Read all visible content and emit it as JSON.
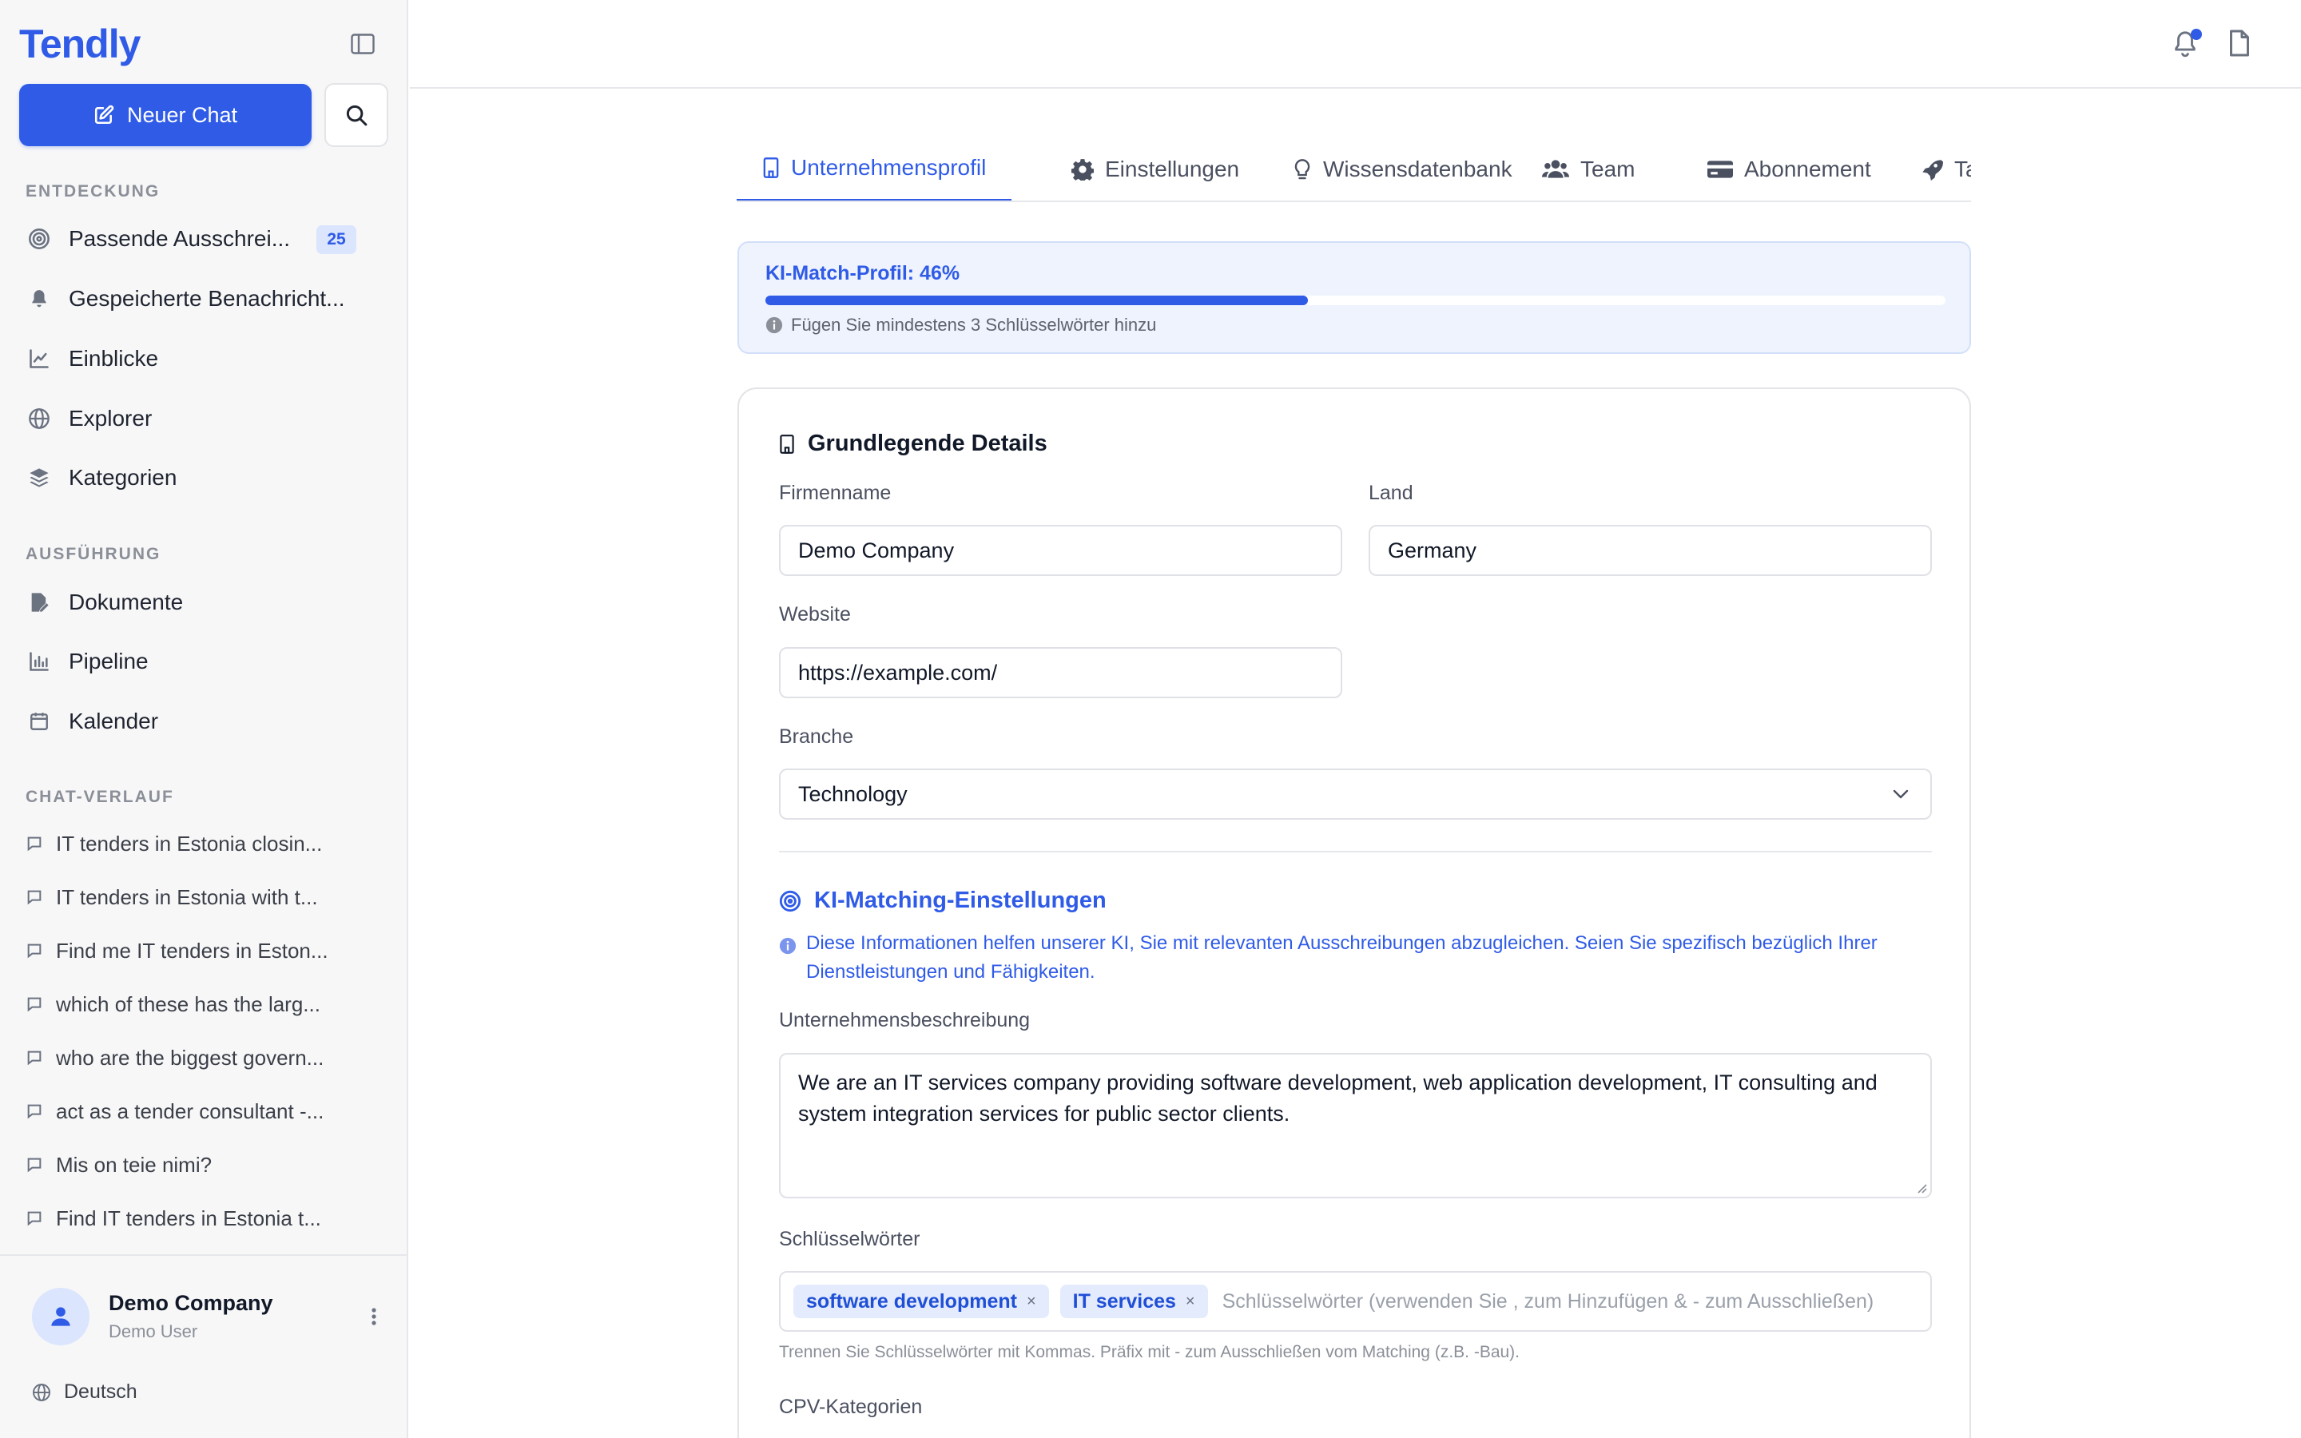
{
  "app": {
    "logo": "Tendly"
  },
  "sidebar": {
    "new_chat_label": "Neuer Chat",
    "sections": {
      "discovery": "ENTDECKUNG",
      "execution": "AUSFÜHRUNG",
      "history": "CHAT-VERLAUF"
    },
    "discovery_items": [
      {
        "label": "Passende Ausschrei...",
        "icon": "target-icon",
        "badge": "25"
      },
      {
        "label": "Gespeicherte Benachricht...",
        "icon": "bell-icon"
      },
      {
        "label": "Einblicke",
        "icon": "chart-line-icon"
      },
      {
        "label": "Explorer",
        "icon": "globe-icon"
      },
      {
        "label": "Kategorien",
        "icon": "layers-icon"
      }
    ],
    "execution_items": [
      {
        "label": "Dokumente",
        "icon": "file-edit-icon"
      },
      {
        "label": "Pipeline",
        "icon": "bar-chart-icon"
      },
      {
        "label": "Kalender",
        "icon": "calendar-icon"
      }
    ],
    "chat_history": [
      "IT tenders in Estonia closin...",
      "IT tenders in Estonia with t...",
      "Find me IT tenders in Eston...",
      "which of these has the larg...",
      "who are the biggest govern...",
      "act as a tender consultant -...",
      "Mis on teie nimi?",
      "Find IT tenders in Estonia t..."
    ],
    "user": {
      "name": "Demo Company",
      "role": "Demo User"
    },
    "language": "Deutsch"
  },
  "tabs": [
    {
      "label": "Unternehmensprofil",
      "icon": "building-icon",
      "active": true
    },
    {
      "label": "Einstellungen",
      "icon": "gear-icon"
    },
    {
      "label": "Wissensdatenbank",
      "icon": "lightbulb-icon"
    },
    {
      "label": "Team",
      "icon": "users-icon"
    },
    {
      "label": "Abonnement",
      "icon": "credit-card-icon"
    },
    {
      "label": "Taa",
      "icon": "rocket-icon"
    }
  ],
  "progress": {
    "title": "KI-Match-Profil: 46%",
    "percent": 46,
    "hint": "Fügen Sie mindestens 3 Schlüsselwörter hinzu"
  },
  "form": {
    "heading": "Grundlegende Details",
    "company_name": {
      "label": "Firmenname",
      "value": "Demo Company"
    },
    "country": {
      "label": "Land",
      "value": "Germany"
    },
    "website": {
      "label": "Website",
      "value": "https://example.com/"
    },
    "industry": {
      "label": "Branche",
      "value": "Technology"
    },
    "ki_heading": "KI-Matching-Einstellungen",
    "ki_info": "Diese Informationen helfen unserer KI, Sie mit relevanten Ausschreibungen abzugleichen. Seien Sie spezifisch bezüglich Ihrer Dienstleistungen und Fähigkeiten.",
    "description": {
      "label": "Unternehmensbeschreibung",
      "value": "We are an IT services company providing software development, web application development, IT consulting and system integration services for public sector clients."
    },
    "keywords": {
      "label": "Schlüsselwörter",
      "tags": [
        "software development",
        "IT services"
      ],
      "placeholder": "Schlüsselwörter (verwenden Sie , zum Hinzufügen & - zum Ausschließen)",
      "helper": "Trennen Sie Schlüsselwörter mit Kommas. Präfix mit - zum Ausschließen vom Matching (z.B. -Bau)."
    },
    "cpv_label": "CPV-Kategorien"
  },
  "colors": {
    "accent": "#2f5be7",
    "sidebar_bg": "#f7f7f8",
    "progress_bg": "#eef3fe"
  }
}
